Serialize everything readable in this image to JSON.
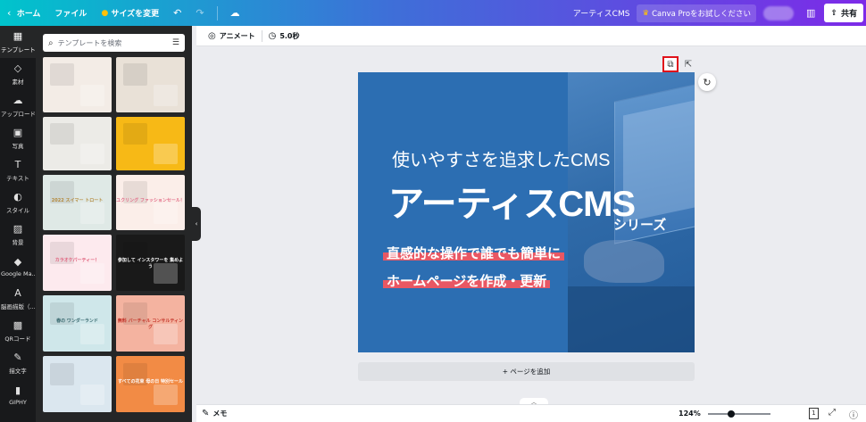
{
  "topbar": {
    "home": "ホーム",
    "file": "ファイル",
    "resize": "サイズを変更",
    "title": "アーティスCMS",
    "pro_button": "Canva Proをお試しください",
    "share": "共有"
  },
  "rail": [
    {
      "label": "テンプレート",
      "icon": "template-icon",
      "glyph": "▦",
      "active": true
    },
    {
      "label": "素材",
      "icon": "elements-icon",
      "glyph": "◇",
      "active": false
    },
    {
      "label": "アップロード",
      "icon": "upload-icon",
      "glyph": "☁",
      "active": false
    },
    {
      "label": "写真",
      "icon": "photo-icon",
      "glyph": "▣",
      "active": false
    },
    {
      "label": "テキスト",
      "icon": "text-icon",
      "glyph": "T",
      "active": false
    },
    {
      "label": "スタイル",
      "icon": "style-icon",
      "glyph": "◐",
      "active": false
    },
    {
      "label": "背景",
      "icon": "background-icon",
      "glyph": "▨",
      "active": false
    },
    {
      "label": "Google Ma...",
      "icon": "google-maps-icon",
      "glyph": "◆",
      "active": false
    },
    {
      "label": "脳画描版（...",
      "icon": "app-icon",
      "glyph": "A",
      "active": false
    },
    {
      "label": "QRコード",
      "icon": "qr-code-icon",
      "glyph": "▩",
      "active": false
    },
    {
      "label": "描文字",
      "icon": "calligraphy-icon",
      "glyph": "✎",
      "active": false
    },
    {
      "label": "GIPHY",
      "icon": "giphy-icon",
      "glyph": "▮",
      "active": false
    }
  ],
  "panel": {
    "search_placeholder": "テンプレートを検索",
    "templates": [
      {
        "bg": "#f3ece6",
        "text": "",
        "color": "#a0625a"
      },
      {
        "bg": "#e9e1d7",
        "text": "",
        "color": "#6d5a4a"
      },
      {
        "bg": "#ecebe7",
        "text": "",
        "color": "#555"
      },
      {
        "bg": "#f7b916",
        "text": "",
        "color": "#fff"
      },
      {
        "bg": "#dfe9e6",
        "text": "2022 スイマー トロート",
        "color": "#b48a3c"
      },
      {
        "bg": "#fbeee9",
        "text": "ユクリング ファッションセール！",
        "color": "#e3708a"
      },
      {
        "bg": "#fdeaee",
        "text": "カラオケパーティー！",
        "color": "#e0607c"
      },
      {
        "bg": "#191919",
        "text": "参加して インスタワーを 集めよう",
        "color": "#fff"
      },
      {
        "bg": "#cfe7ea",
        "text": "春の ワンダーランド",
        "color": "#3a6a70"
      },
      {
        "bg": "#f4b3a0",
        "text": "無料 バーチャル コンサルティング",
        "color": "#c4352a"
      },
      {
        "bg": "#dbe7ef",
        "text": "",
        "color": "#d0607c"
      },
      {
        "bg": "#f28b45",
        "text": "すべての花束 母の日 特別セール",
        "color": "#fff"
      }
    ]
  },
  "toolbar": {
    "animate": "アニメート",
    "duration": "5.0秒"
  },
  "design": {
    "subtitle": "使いやすさを追求したCMS",
    "title": "アーティスCMS",
    "series": "シリーズ",
    "line1": "直感的な操作で誰でも簡単に",
    "line2": "ホームページを作成・更新"
  },
  "add_page": "+ ページを追加",
  "bottom": {
    "memo": "メモ",
    "zoom": "124%",
    "page_count": "1"
  },
  "colors": {
    "accent_highlight": "#e0121b",
    "design_blue": "#2c6eb2",
    "stripe": "#e95763"
  }
}
